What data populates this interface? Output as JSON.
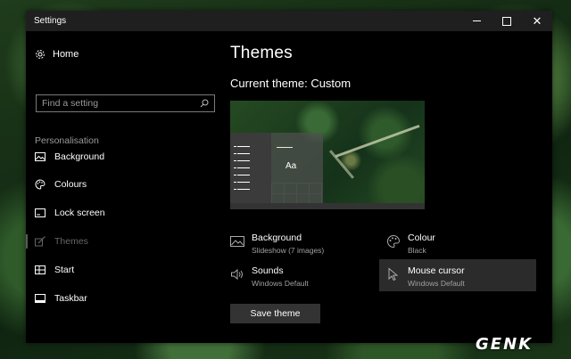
{
  "window": {
    "title": "Settings",
    "controls": {
      "minimize": "minimize",
      "maximize": "maximize",
      "close": "close"
    }
  },
  "nav": {
    "home_label": "Home",
    "search_placeholder": "Find a setting",
    "section_label": "Personalisation",
    "items": [
      {
        "label": "Background",
        "icon": "picture-icon",
        "active": false
      },
      {
        "label": "Colours",
        "icon": "palette-icon",
        "active": false
      },
      {
        "label": "Lock screen",
        "icon": "lock-screen-icon",
        "active": false
      },
      {
        "label": "Themes",
        "icon": "brush-icon",
        "active": true
      },
      {
        "label": "Start",
        "icon": "start-grid-icon",
        "active": false
      },
      {
        "label": "Taskbar",
        "icon": "taskbar-icon",
        "active": false
      }
    ]
  },
  "main": {
    "title": "Themes",
    "current_theme": "Current theme: Custom",
    "preview_text": "Aa",
    "tiles": {
      "background": {
        "name": "Background",
        "value": "Slideshow (7 images)"
      },
      "colour": {
        "name": "Colour",
        "value": "Black"
      },
      "sounds": {
        "name": "Sounds",
        "value": "Windows Default"
      },
      "mouse_cursor": {
        "name": "Mouse cursor",
        "value": "Windows Default"
      }
    },
    "save_button": "Save theme"
  },
  "watermark": "GENK"
}
